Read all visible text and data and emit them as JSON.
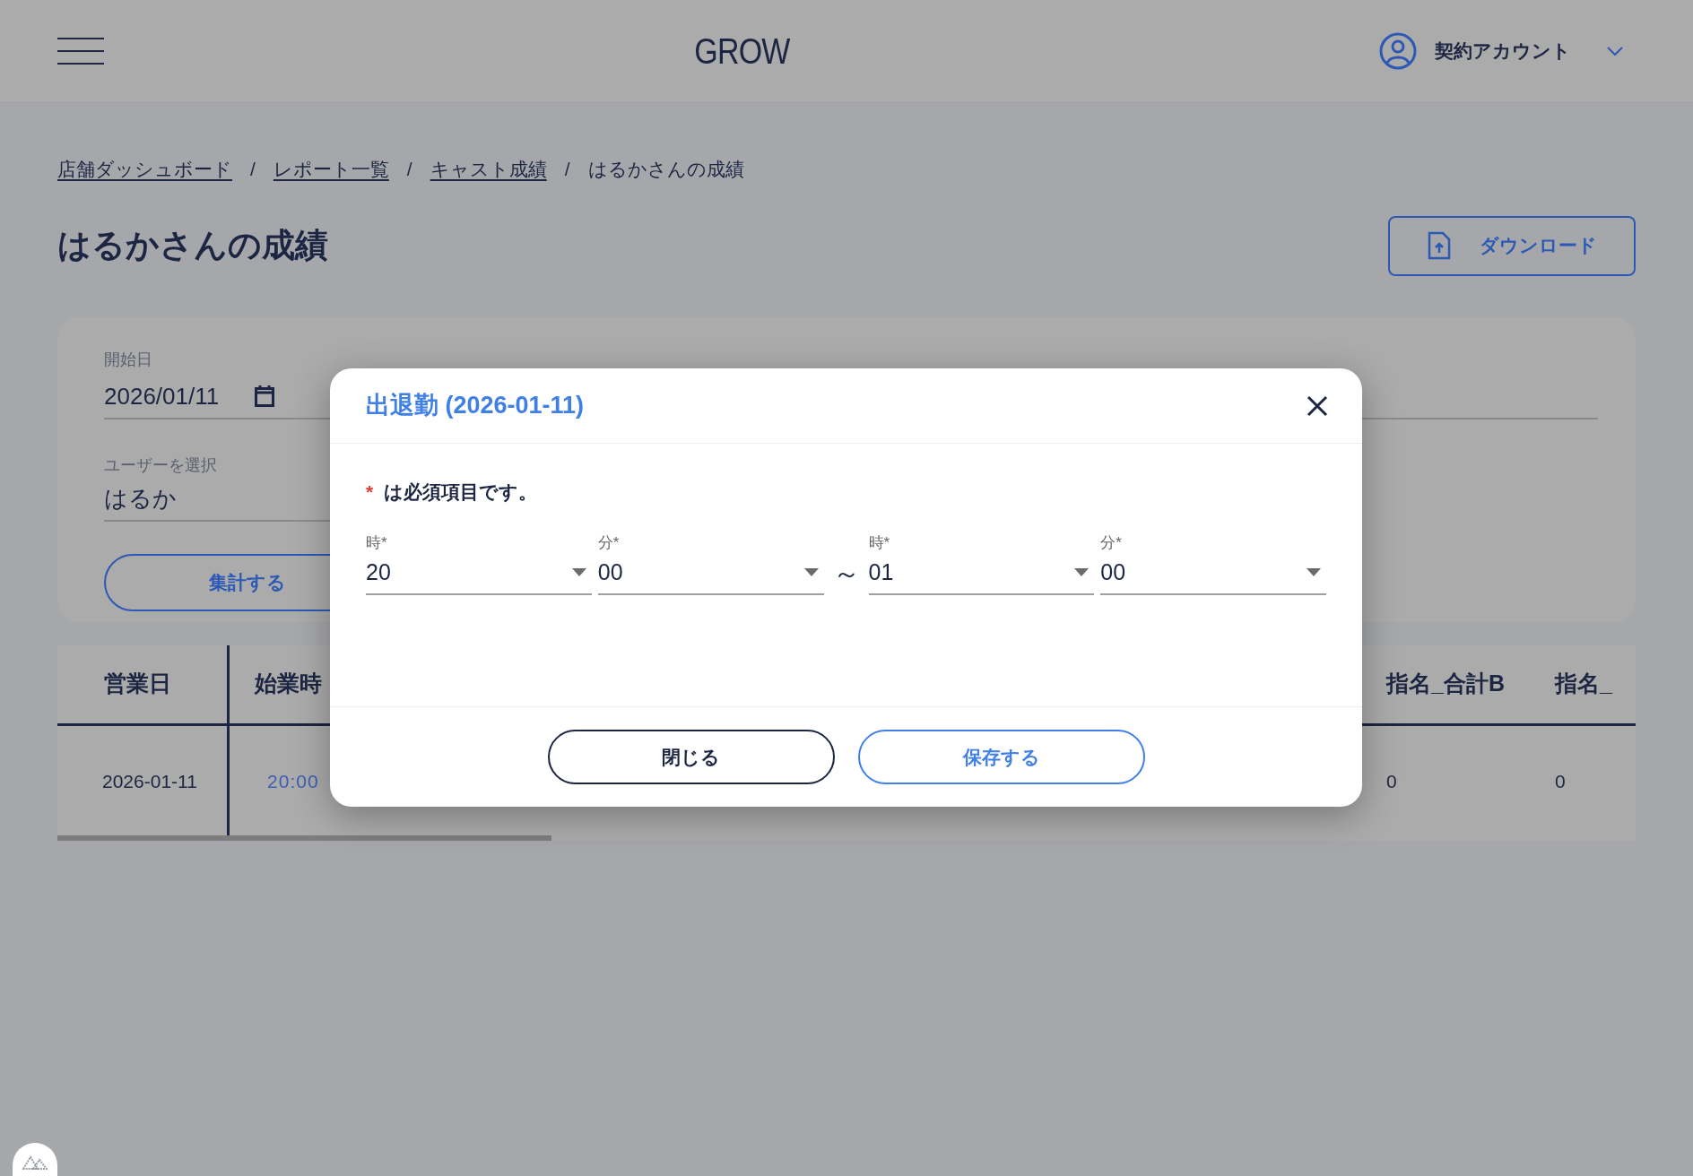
{
  "header": {
    "logo": "GROW",
    "account": "契約アカウント"
  },
  "breadcrumb": [
    {
      "label": "店舗ダッシュボード",
      "link": true
    },
    {
      "label": "レポート一覧",
      "link": true
    },
    {
      "label": "キャスト成績",
      "link": true
    },
    {
      "label": "はるかさんの成績",
      "link": false
    }
  ],
  "breadcrumb_separator": "/",
  "page_title": "はるかさんの成績",
  "download_button": "ダウンロード",
  "filters": {
    "start_date": {
      "label": "開始日",
      "value": "2026/01/11"
    },
    "user": {
      "label": "ユーザーを選択",
      "value": "はるか"
    },
    "submit": "集計する"
  },
  "table": {
    "columns": [
      {
        "label": "営業日"
      },
      {
        "label": "始業時"
      },
      {
        "label": "指名_合計B"
      },
      {
        "label": "指名_"
      }
    ],
    "rows": [
      {
        "cells": [
          {
            "text": "2026-01-11",
            "kind": "plain"
          },
          {
            "text": "20:00",
            "kind": "link"
          },
          {
            "text": "0",
            "kind": "plain"
          },
          {
            "text": "0",
            "kind": "plain"
          }
        ]
      }
    ]
  },
  "dialog": {
    "title": "出退勤 (2026-01-11)",
    "required_mark": "*",
    "required_note": "は必須項目です。",
    "fields": [
      {
        "label": "時*",
        "value": "20"
      },
      {
        "label": "分*",
        "value": "00"
      },
      {
        "label": "時*",
        "value": "01"
      },
      {
        "label": "分*",
        "value": "00"
      }
    ],
    "range_separator": "～",
    "buttons": [
      {
        "label": "閉じる",
        "kind": "secondary"
      },
      {
        "label": "保存する",
        "kind": "primary"
      }
    ]
  }
}
